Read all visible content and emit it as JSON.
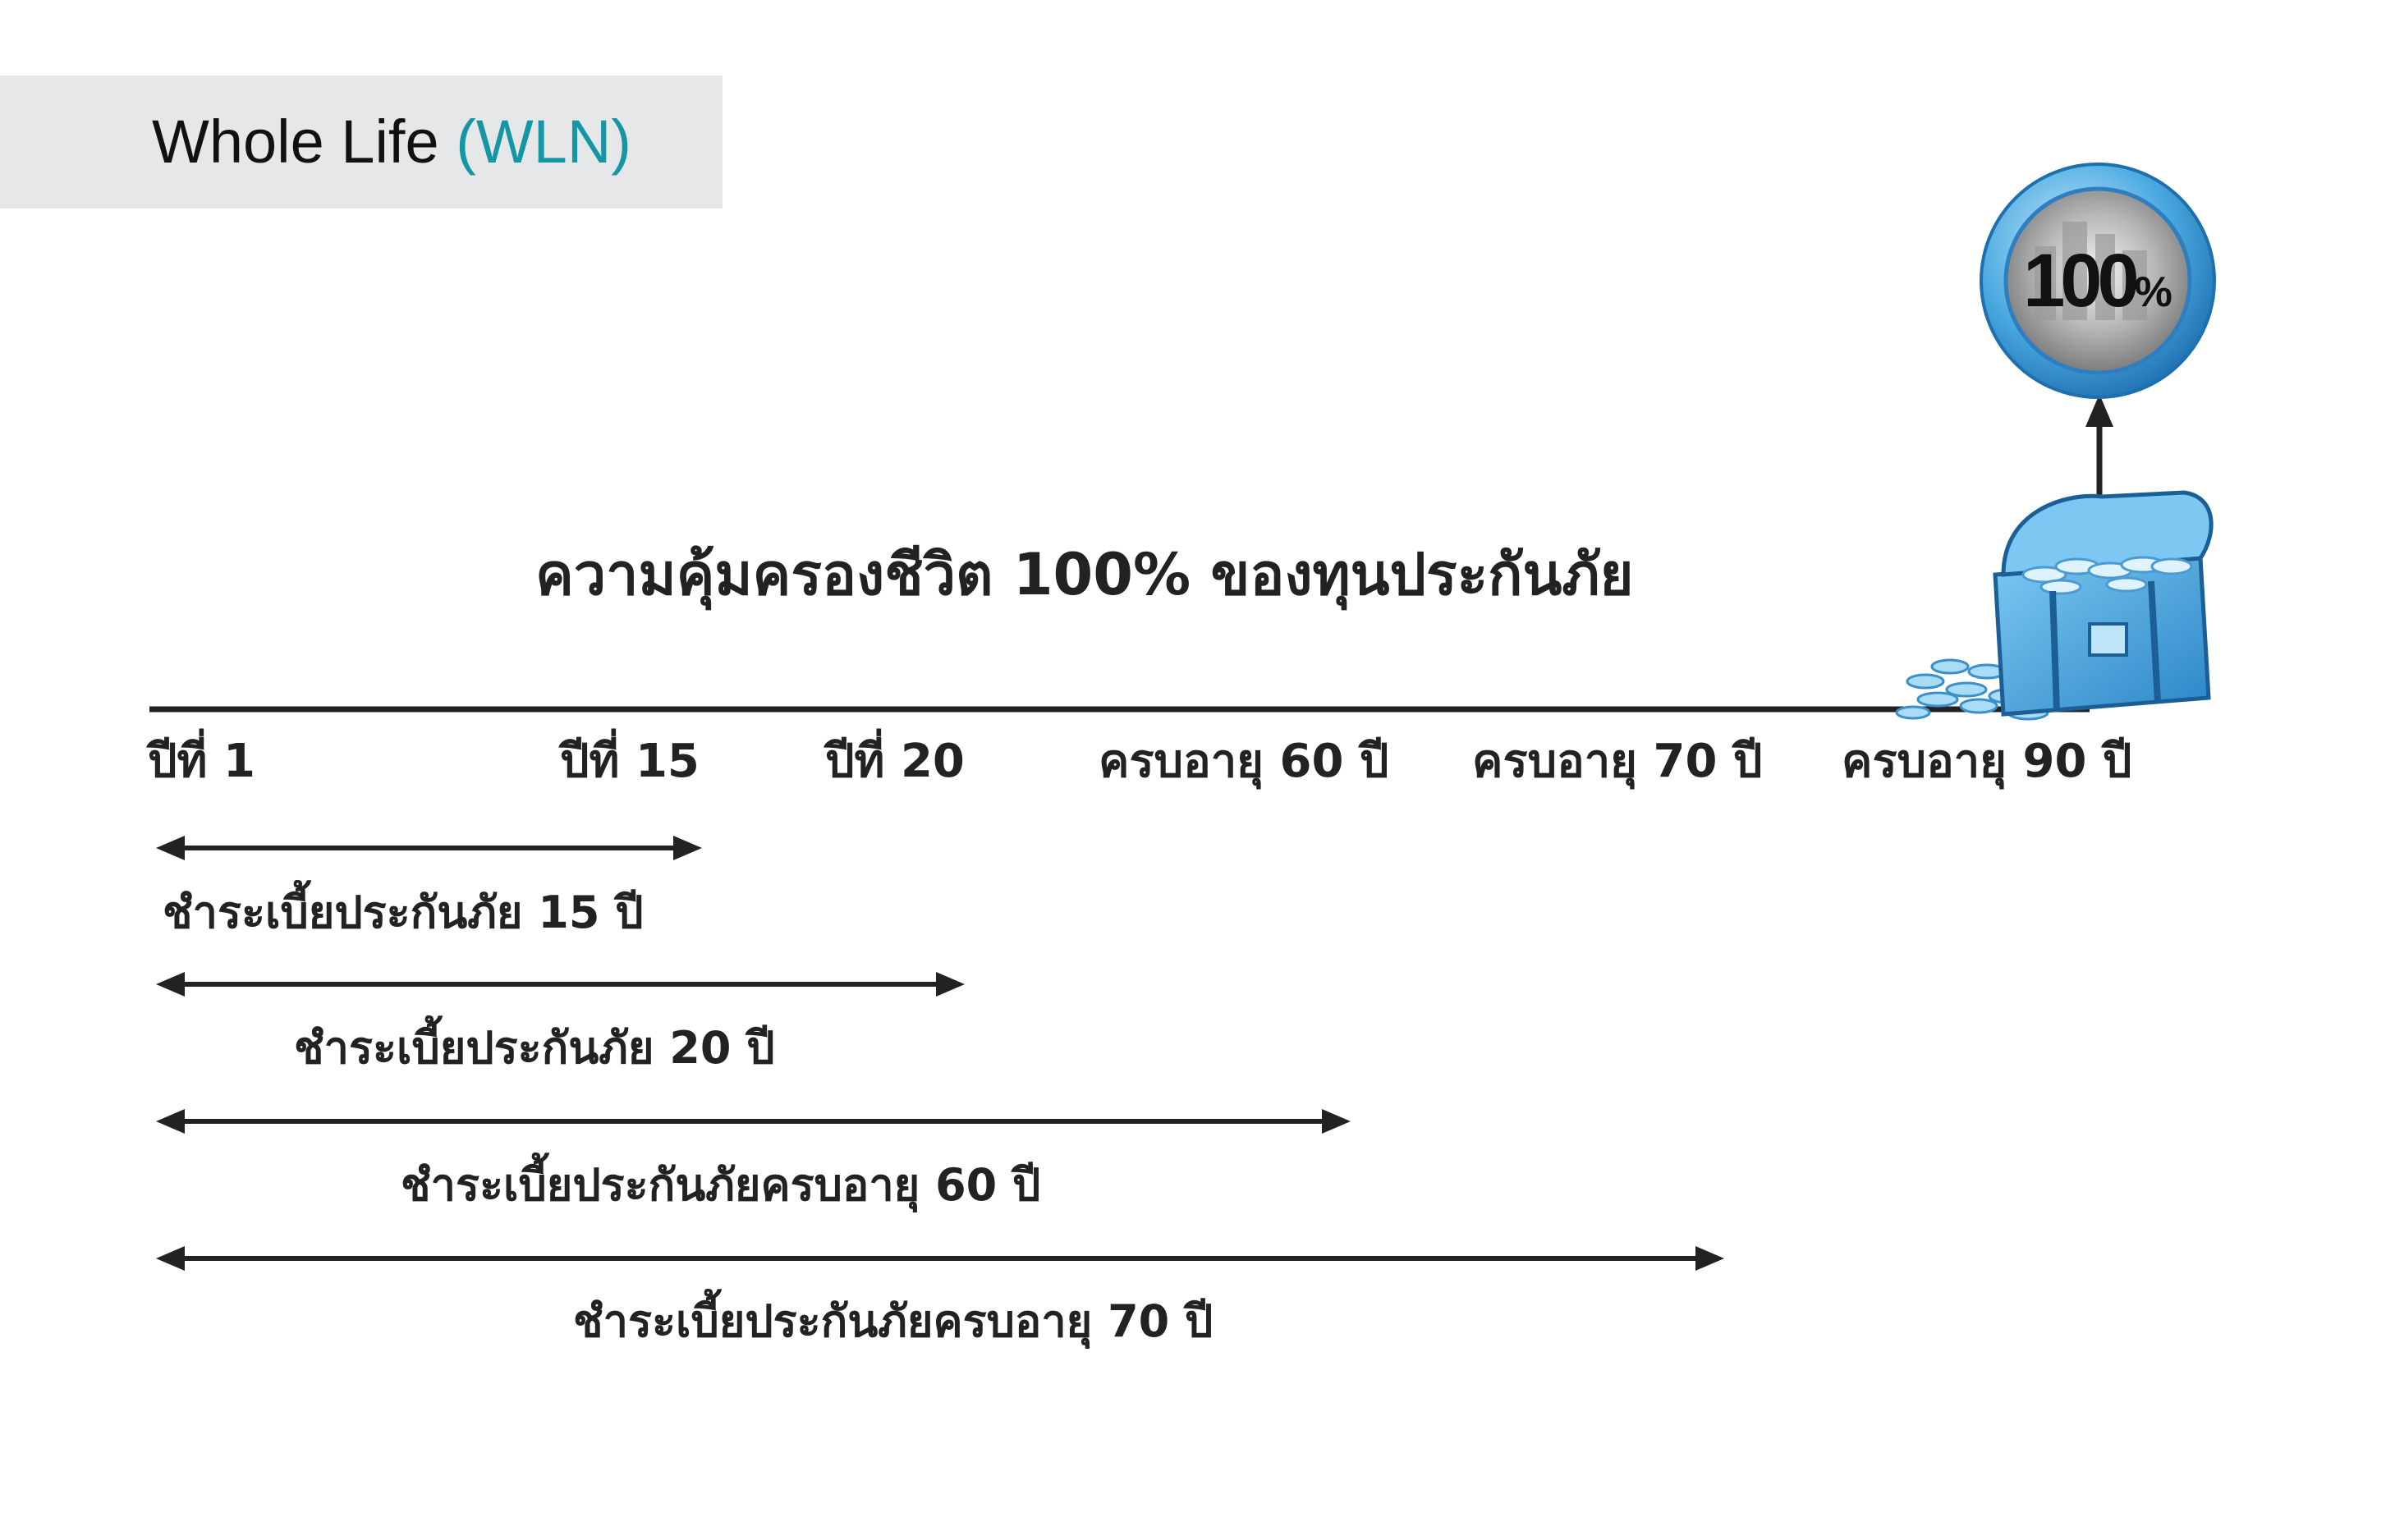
{
  "header": {
    "title": "Whole Life",
    "code": "(WLN)",
    "band_color": "#e6e7e8",
    "accent_color": "#1596a4"
  },
  "diagram": {
    "title": "ความคุ้มครองชีวิต 100% ของทุนประกันภัย",
    "timeline_labels": [
      "ปีที่ 1",
      "ปีที่ 15",
      "ปีที่ 20",
      "ครบอายุ 60 ปี",
      "ครบอายุ 70 ปี",
      "ครบอายุ 90 ปี"
    ],
    "payment_periods": [
      "ชำระเบี้ยประกันภัย 15 ปี",
      "ชำระเบี้ยประกันภัย 20 ปี",
      "ชำระเบี้ยประกันภัยครบอายุ 60 ปี",
      "ชำระเบี้ยประกันภัยครบอายุ 70 ปี"
    ],
    "badge": {
      "value": "100",
      "unit": "%",
      "color": "#4aa9e0"
    },
    "icons": [
      "treasure-chest-icon",
      "coverage-badge-icon"
    ]
  }
}
